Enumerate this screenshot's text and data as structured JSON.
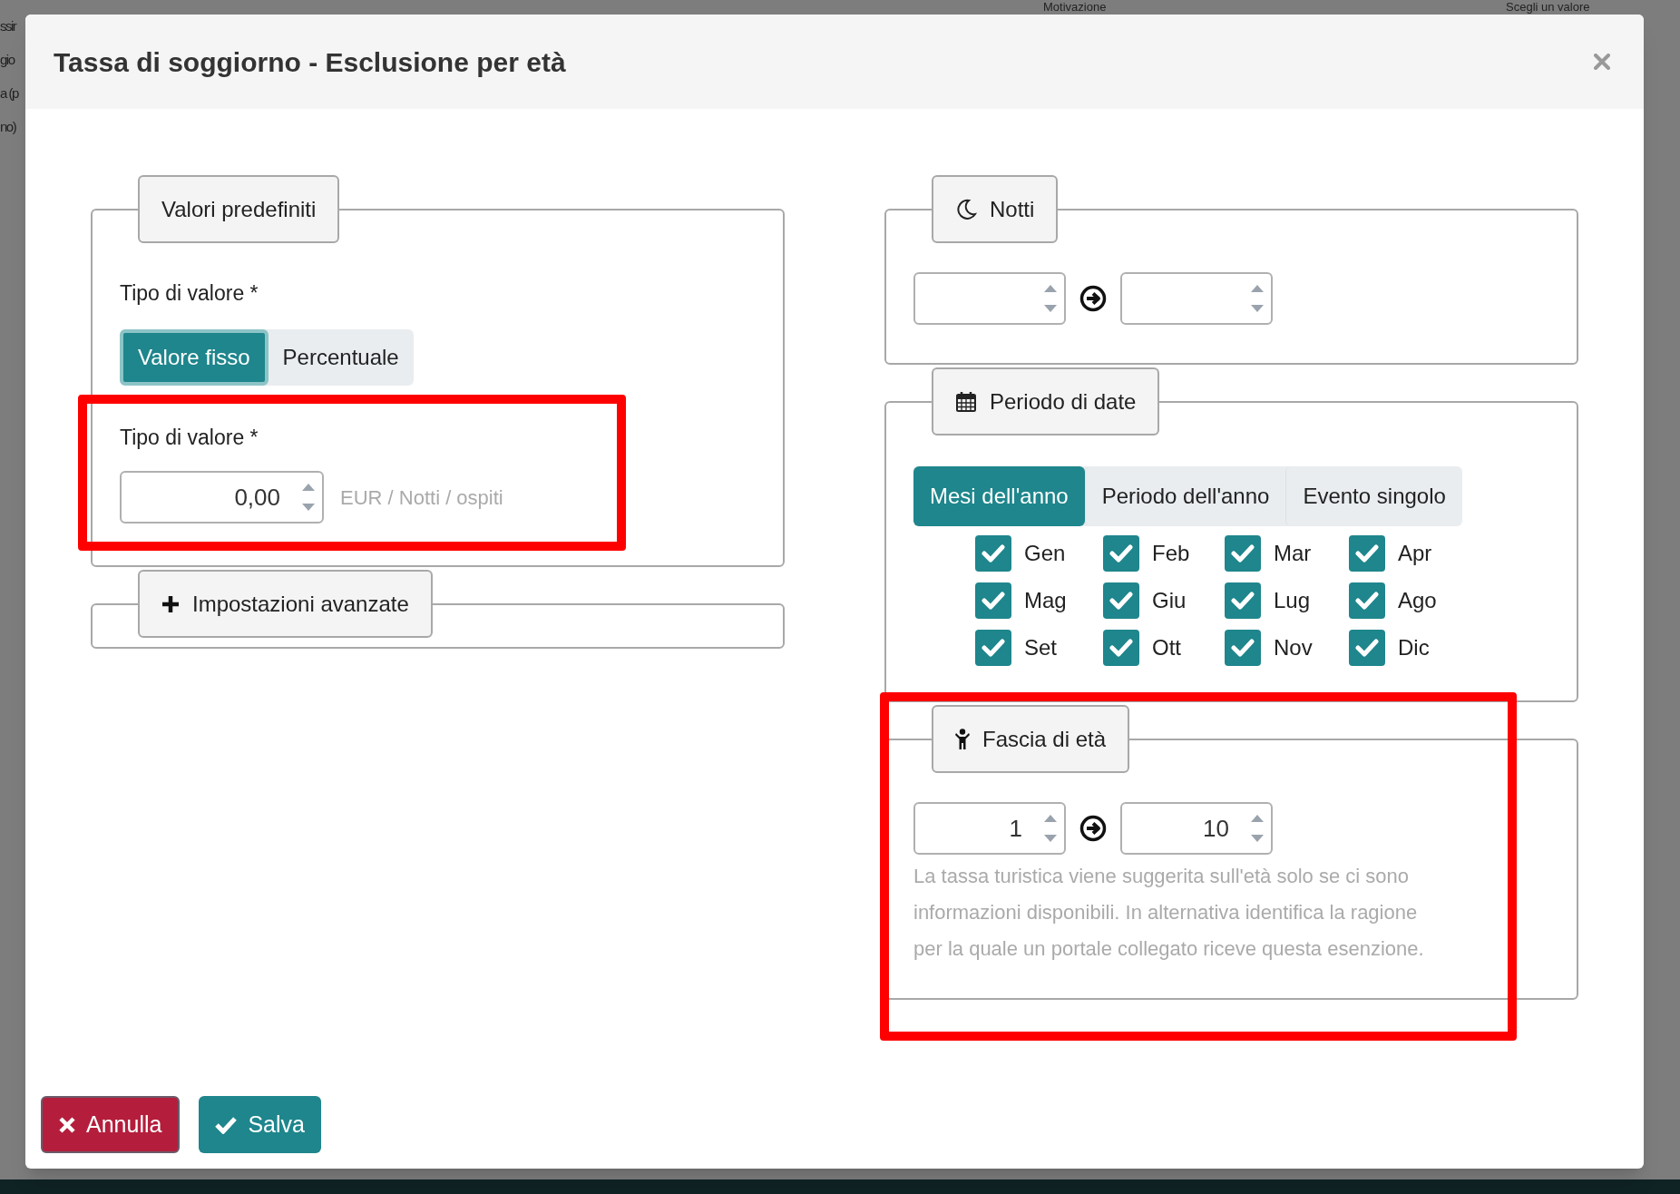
{
  "background": {
    "columns": [
      "Motivazione",
      "Scegli un valore"
    ],
    "row_fragments": [
      "ssir",
      "gio",
      "a (p",
      "no)"
    ]
  },
  "dialog": {
    "title": "Tassa di soggiorno - Esclusione per età"
  },
  "defaults": {
    "legend": "Valori predefiniti",
    "type_label": "Tipo di valore  *",
    "value_types": [
      {
        "label": "Valore fisso",
        "selected": true
      },
      {
        "label": "Percentuale",
        "selected": false
      }
    ],
    "amount_label": "Tipo di valore *",
    "amount": "0,00",
    "unit": "EUR / Notti / ospiti",
    "highlighted": true
  },
  "advanced": {
    "label": "Impostazioni avanzate"
  },
  "nights": {
    "legend": "Notti"
  },
  "date_period": {
    "legend": "Periodo di date",
    "modes": [
      {
        "label": "Mesi dell'anno",
        "selected": true
      },
      {
        "label": "Periodo dell'anno",
        "selected": false
      },
      {
        "label": "Evento singolo",
        "selected": false
      }
    ],
    "months": [
      {
        "label": "Gen",
        "checked": true
      },
      {
        "label": "Feb",
        "checked": true
      },
      {
        "label": "Mar",
        "checked": true
      },
      {
        "label": "Apr",
        "checked": true
      },
      {
        "label": "Mag",
        "checked": true
      },
      {
        "label": "Giu",
        "checked": true
      },
      {
        "label": "Lug",
        "checked": true
      },
      {
        "label": "Ago",
        "checked": true
      },
      {
        "label": "Set",
        "checked": true
      },
      {
        "label": "Ott",
        "checked": true
      },
      {
        "label": "Nov",
        "checked": true
      },
      {
        "label": "Dic",
        "checked": true
      }
    ]
  },
  "age_range": {
    "legend": "Fascia di età",
    "from": "1",
    "to": "10",
    "highlighted": true,
    "help": "La tassa turistica viene suggerita sull'età solo se ci sono informazioni disponibili. In alternativa identifica la ragione per la quale un portale collegato riceve questa esenzione."
  },
  "buttons": [
    {
      "kind": "cancel",
      "label": "Annulla"
    },
    {
      "kind": "save",
      "label": "Salva"
    }
  ]
}
